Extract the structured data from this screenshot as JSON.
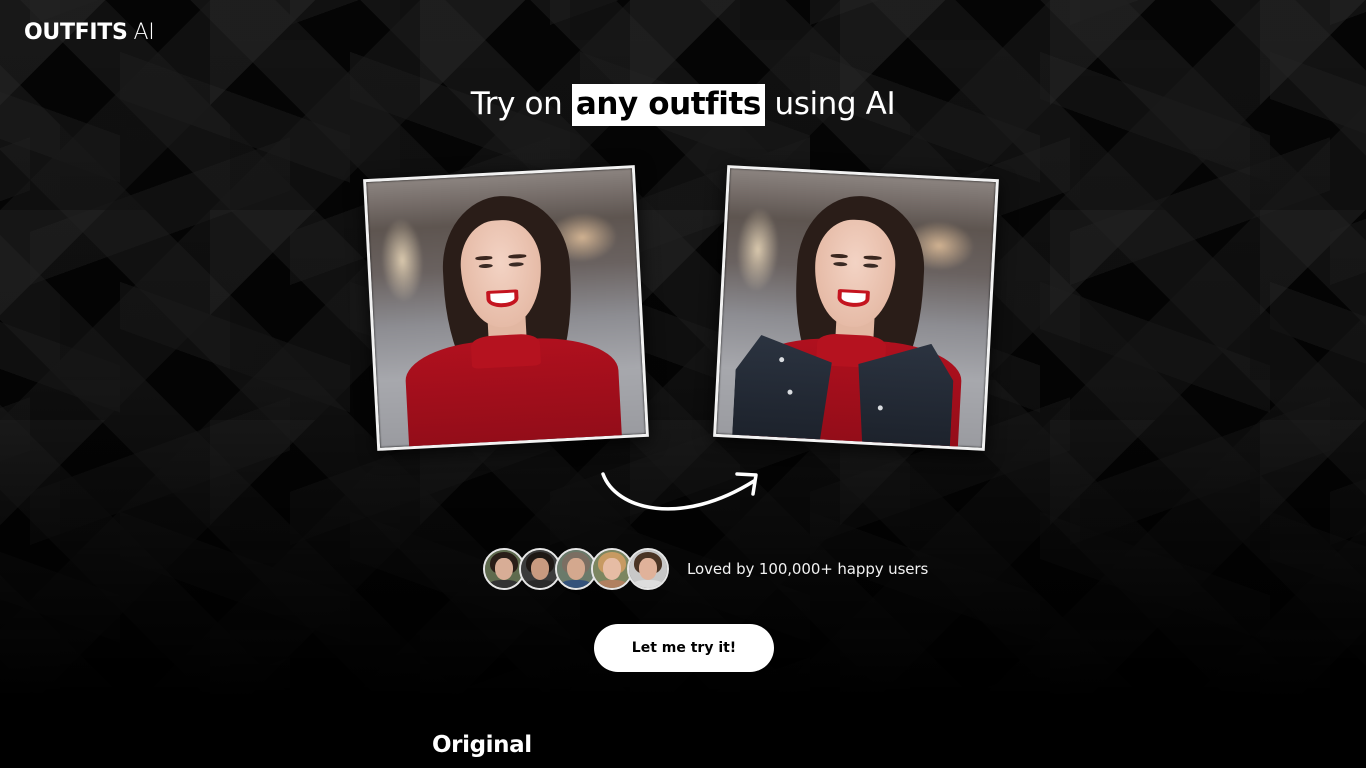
{
  "brand": {
    "name_bold": "OUTFITS",
    "name_light": "AI"
  },
  "hero": {
    "headline_prefix": "Try on",
    "headline_highlight": "any outfits",
    "headline_suffix": "using AI"
  },
  "comparison": {
    "before_image": {
      "alt": "Smiling woman with dark wavy hair wearing a red turtleneck sweater",
      "icon": "photo-original"
    },
    "after_image": {
      "alt": "Same woman wearing a black leather jacket over the red turtleneck",
      "icon": "photo-result"
    },
    "arrow_icon": "curved-arrow-right-icon"
  },
  "social_proof": {
    "avatars": [
      {
        "label": "user-avatar-1"
      },
      {
        "label": "user-avatar-2"
      },
      {
        "label": "user-avatar-3"
      },
      {
        "label": "user-avatar-4"
      },
      {
        "label": "user-avatar-5"
      }
    ],
    "text": "Loved by 100,000+ happy users"
  },
  "cta": {
    "label": "Let me try it!"
  },
  "section": {
    "title": "Original"
  },
  "colors": {
    "background": "#000000",
    "text": "#ffffff",
    "highlight_bg": "#ffffff",
    "highlight_text": "#000000",
    "button_bg": "#ffffff",
    "button_text": "#000000"
  }
}
